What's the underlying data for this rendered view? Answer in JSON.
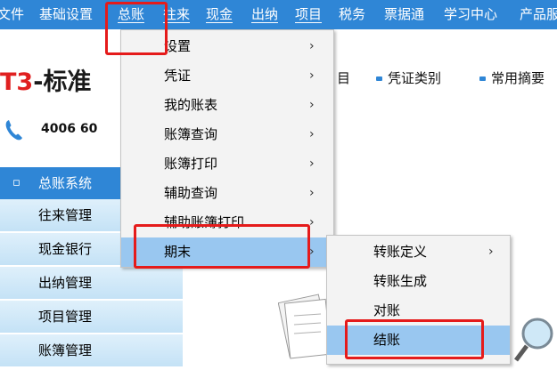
{
  "menubar": {
    "items": [
      "文件",
      "基础设置",
      "总账",
      "往来",
      "现金",
      "出纳",
      "项目",
      "税务",
      "票据通",
      "学习中心",
      "产品服"
    ]
  },
  "logo": {
    "prefix": "T3",
    "dash": "-",
    "text": "标准"
  },
  "phone": "4006 60",
  "toolbar": {
    "item1": "目",
    "item2": "凭证类别",
    "item3": "常用摘要"
  },
  "nav": {
    "header": "总账系统",
    "header_mark": "▫",
    "items": [
      "往来管理",
      "现金银行",
      "出纳管理",
      "项目管理",
      "账簿管理"
    ]
  },
  "dropdown": {
    "items": [
      {
        "label": "设置",
        "arrow": "›"
      },
      {
        "label": "凭证",
        "arrow": "›"
      },
      {
        "label": "我的账表",
        "arrow": "›"
      },
      {
        "label": "账簿查询",
        "arrow": "›"
      },
      {
        "label": "账簿打印",
        "arrow": "›"
      },
      {
        "label": "辅助查询",
        "arrow": "›"
      },
      {
        "label": "辅助账簿打印",
        "arrow": "›"
      },
      {
        "label": "期末",
        "arrow": "›"
      }
    ]
  },
  "submenu": {
    "items": [
      {
        "label": "转账定义",
        "arrow": "›"
      },
      {
        "label": "转账生成",
        "arrow": ""
      },
      {
        "label": "对账",
        "arrow": ""
      },
      {
        "label": "结账",
        "arrow": ""
      }
    ]
  },
  "colors": {
    "accent": "#2f86d6",
    "highlight": "#e51b1b",
    "selected": "#99c7f0"
  }
}
